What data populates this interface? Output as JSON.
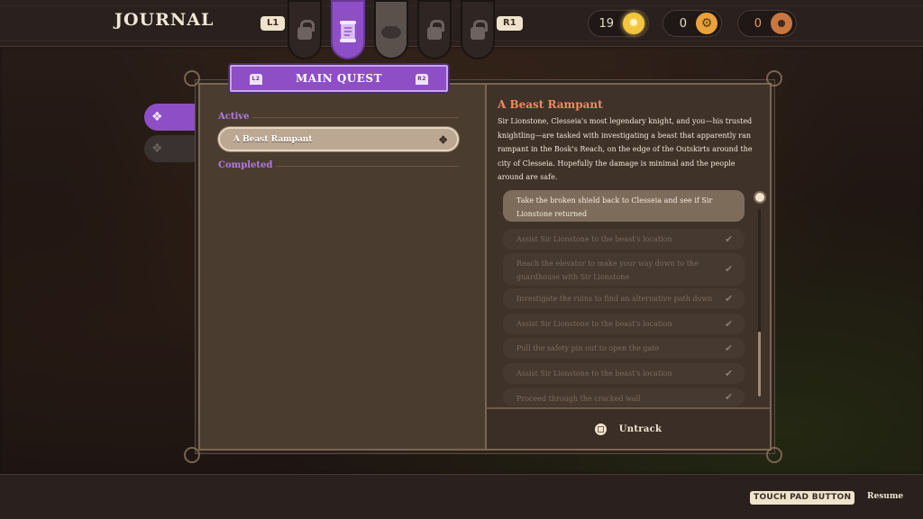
{
  "header": {
    "title": "JOURNAL",
    "left_trigger": "L1",
    "right_trigger": "R1"
  },
  "tabs": [
    {
      "icon": "lock-icon",
      "state": "locked"
    },
    {
      "icon": "scroll-icon",
      "state": "active"
    },
    {
      "icon": "pouch-icon",
      "state": "disabled"
    },
    {
      "icon": "lock-icon",
      "state": "locked"
    },
    {
      "icon": "lock-icon",
      "state": "locked"
    }
  ],
  "currencies": [
    {
      "value": "19",
      "icon": "sun-coin-icon",
      "color": "#f2c53d"
    },
    {
      "value": "0",
      "icon": "gear-token-icon",
      "color": "#e8a33a"
    },
    {
      "value": "0",
      "icon": "donut-icon",
      "color": "#c7773f"
    }
  ],
  "panel": {
    "category_title": "MAIN QUEST",
    "category_left": "L2",
    "category_right": "R2",
    "active_label": "Active",
    "completed_label": "Completed",
    "active_quests": [
      "A Beast Rampant"
    ]
  },
  "quest": {
    "title": "A Beast Rampant",
    "description": "Sir Lionstone, Clesseia's most legendary knight, and you—his trusted knightling—are tasked with investigating a beast that apparently ran rampant in the Bosk's Reach, on the edge of the Outskirts around the city of Clesseia. Hopefully the damage is minimal and the people around are safe.",
    "objectives": [
      {
        "text": "Take the broken shield back to Clesseia and see if Sir Lionstone returned",
        "done": false
      },
      {
        "text": "Assist Sir Lionstone to the beast's location",
        "done": true
      },
      {
        "text": "Reach the elevator to make your way down to the guardhouse with Sir Lionstone",
        "done": true
      },
      {
        "text": "Investigate the ruins to find an alternative path down",
        "done": true
      },
      {
        "text": "Assist Sir Lionstone to the beast's location",
        "done": true
      },
      {
        "text": "Pull the safety pin out to open the gate",
        "done": true
      },
      {
        "text": "Assist Sir Lionstone to the beast's location",
        "done": true
      },
      {
        "text": "Proceed through the cracked wall",
        "done": true
      }
    ],
    "untrack_label": "Untrack"
  },
  "footer": {
    "button_label": "TOUCH PAD BUTTON",
    "action_label": "Resume"
  }
}
